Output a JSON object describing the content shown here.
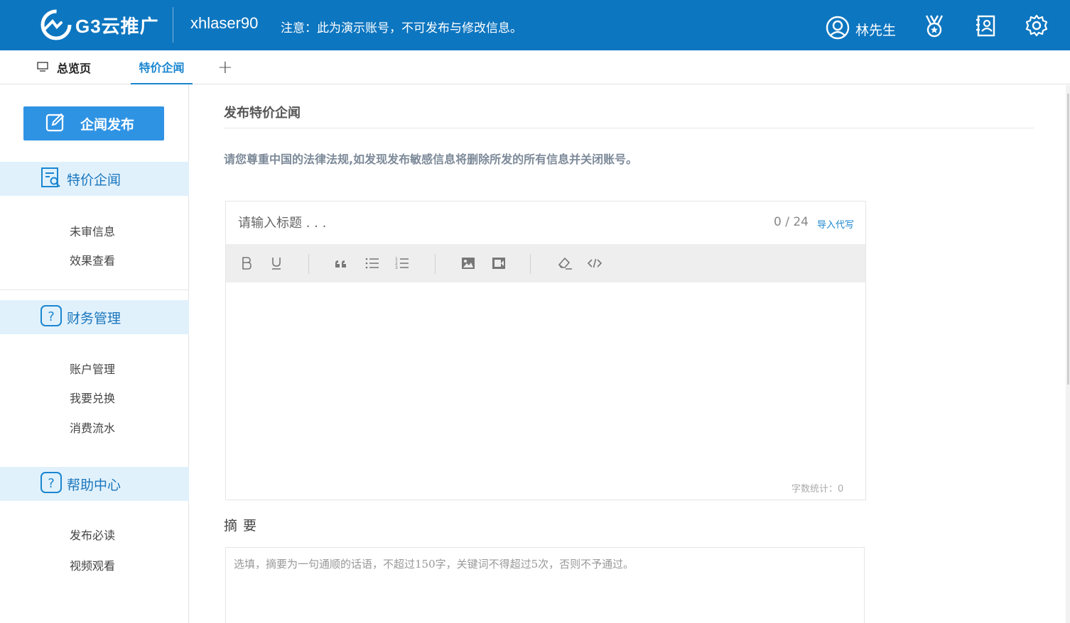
{
  "header": {
    "logo_text": "G3云推广",
    "account": "xhlaser90",
    "notice": "注意：此为演示账号，不可发布与修改信息。",
    "user_name": "林先生"
  },
  "tabs": {
    "home": "总览页",
    "active": "特价企闻",
    "add": "+"
  },
  "sidebar": {
    "publish_button": "企闻发布",
    "sections": [
      {
        "label": "特价企闻",
        "items": [
          "未审信息",
          "效果查看"
        ]
      },
      {
        "label": "财务管理",
        "items": [
          "账户管理",
          "我要兑换",
          "消费流水"
        ]
      },
      {
        "label": "帮助中心",
        "items": [
          "发布必读",
          "视频观看"
        ]
      }
    ]
  },
  "main": {
    "page_title": "发布特价企闻",
    "warning": "请您尊重中国的法律法规,如发现发布敏感信息将删除所发的所有信息并关闭账号。",
    "editor": {
      "title_placeholder": "请输入标题 . . .",
      "counter": "0 / 24",
      "import_link": "导入代写",
      "word_count": "字数统计：0"
    },
    "summary": {
      "label": "摘 要",
      "placeholder": "选填，摘要为一句通顺的话语，不超过150字，关键词不得超过5次，否则不予通过。"
    }
  },
  "icons": {
    "user": "user-circle-icon",
    "medal": "medal-icon",
    "contacts": "contacts-book-icon",
    "settings": "gear-icon",
    "publish": "edit-icon",
    "news": "news-search-icon",
    "help": "question-icon"
  },
  "colors": {
    "header_bg": "#0d76c0",
    "accent": "#2f93e4",
    "active_tab": "#1a86d0",
    "section_bg": "#e1f1fc"
  }
}
